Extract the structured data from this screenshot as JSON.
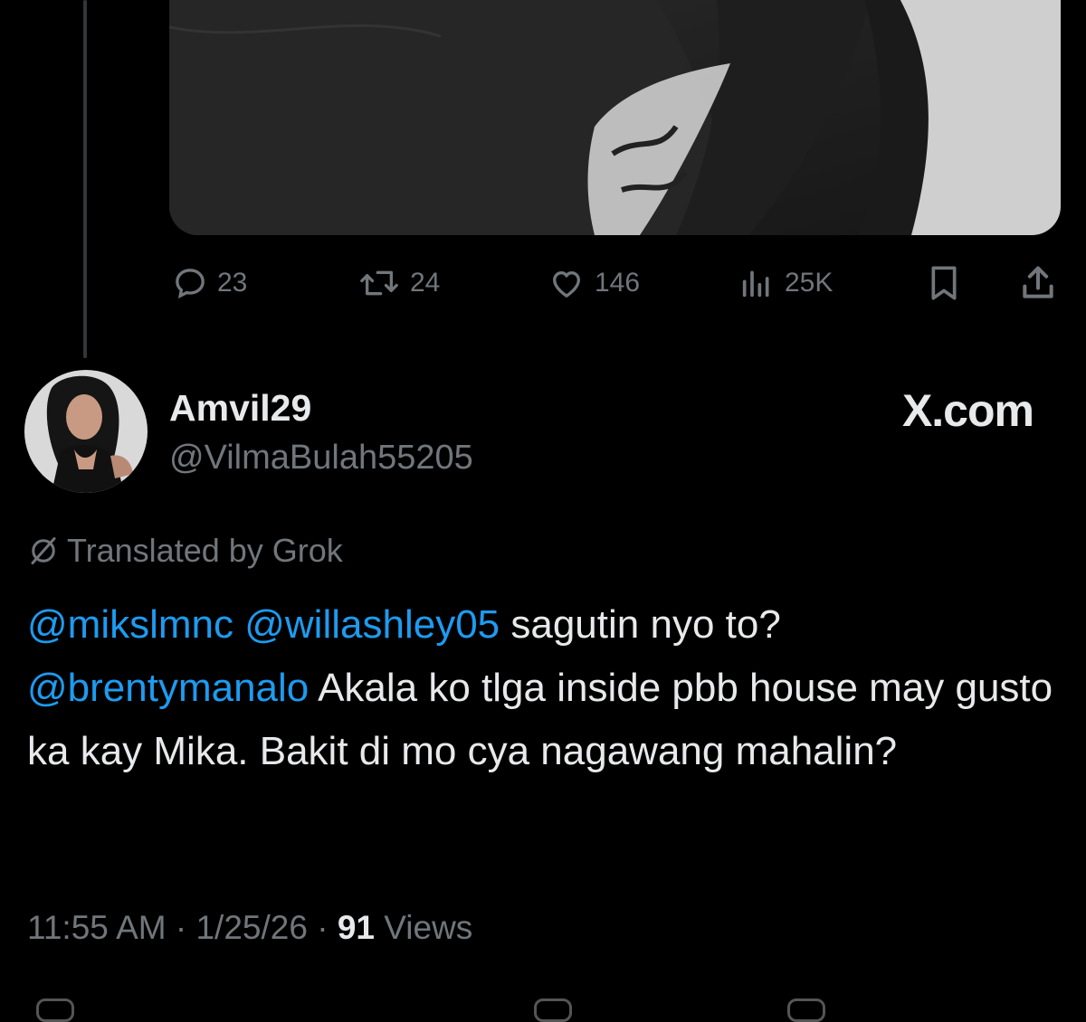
{
  "post_actions": {
    "replies": "23",
    "reposts": "24",
    "likes": "146",
    "views": "25K",
    "icons": [
      "reply-icon",
      "repost-icon",
      "like-icon",
      "views-icon",
      "bookmark-icon",
      "share-icon"
    ]
  },
  "reply": {
    "display_name": "Amvil29",
    "handle": "@VilmaBulah55205",
    "brand": "X.com",
    "translated_label": "Translated by Grok",
    "mentions": [
      "@mikslmnc",
      "@willashley05",
      "@brentymanalo"
    ],
    "text_part1": " sagutin nyo to?",
    "text_part2": " Akala ko tlga inside pbb house may gusto ka kay Mika. Bakit di mo cya nagawang mahalin?",
    "time": "11:55 AM",
    "date": "1/25/26",
    "views_count": "91",
    "views_label": "Views",
    "separator": "·"
  },
  "colors": {
    "background": "#000000",
    "text": "#e7e9ea",
    "muted": "#71767b",
    "mention": "#1d9bf0"
  }
}
